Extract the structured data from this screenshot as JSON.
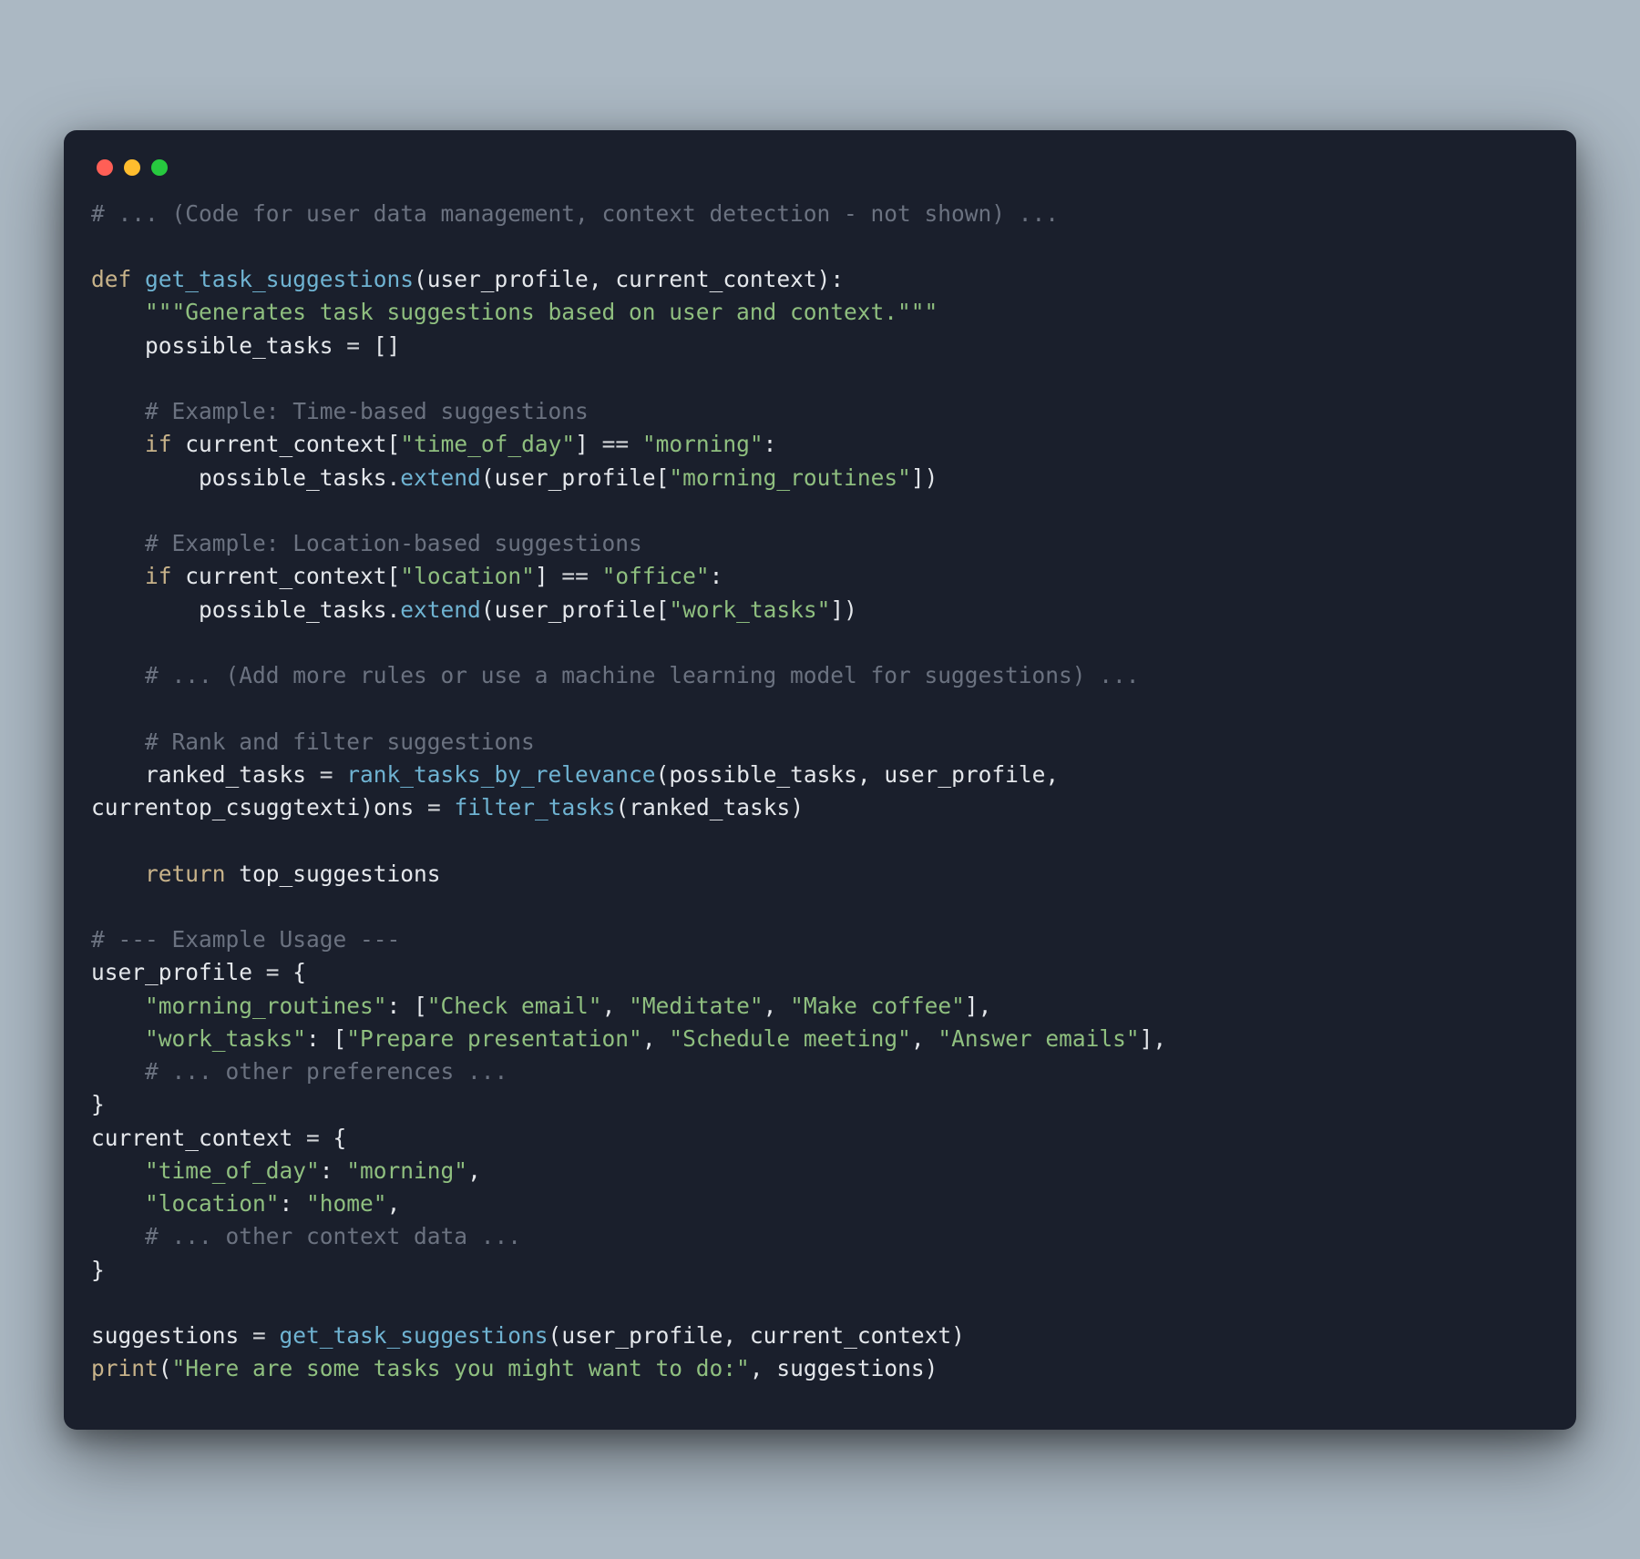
{
  "window": {
    "controls": [
      "close",
      "minimize",
      "zoom"
    ]
  },
  "code": {
    "lines": [
      {
        "indent": 0,
        "tokens": [
          {
            "t": "# ... (Code for user data management, context detection - not shown) ...",
            "c": "comment"
          }
        ]
      },
      {
        "indent": 0,
        "tokens": []
      },
      {
        "indent": 0,
        "tokens": [
          {
            "t": "def ",
            "c": "kw"
          },
          {
            "t": "get_task_suggestions",
            "c": "fn"
          },
          {
            "t": "(",
            "c": "punc"
          },
          {
            "t": "user_profile",
            "c": "name"
          },
          {
            "t": ", ",
            "c": "punc"
          },
          {
            "t": "current_context",
            "c": "name"
          },
          {
            "t": "):",
            "c": "punc"
          }
        ]
      },
      {
        "indent": 1,
        "tokens": [
          {
            "t": "\"\"\"Generates task suggestions based on user and context.\"\"\"",
            "c": "str"
          }
        ]
      },
      {
        "indent": 1,
        "tokens": [
          {
            "t": "possible_tasks ",
            "c": "name"
          },
          {
            "t": "= ",
            "c": "op"
          },
          {
            "t": "[]",
            "c": "punc"
          }
        ]
      },
      {
        "indent": 0,
        "tokens": []
      },
      {
        "indent": 1,
        "tokens": [
          {
            "t": "# Example: Time-based suggestions",
            "c": "comment"
          }
        ]
      },
      {
        "indent": 1,
        "tokens": [
          {
            "t": "if ",
            "c": "kw"
          },
          {
            "t": "current_context",
            "c": "name"
          },
          {
            "t": "[",
            "c": "punc"
          },
          {
            "t": "\"time_of_day\"",
            "c": "str"
          },
          {
            "t": "]",
            "c": "punc"
          },
          {
            "t": " == ",
            "c": "op"
          },
          {
            "t": "\"morning\"",
            "c": "str"
          },
          {
            "t": ":",
            "c": "punc"
          }
        ]
      },
      {
        "indent": 2,
        "tokens": [
          {
            "t": "possible_tasks",
            "c": "name"
          },
          {
            "t": ".",
            "c": "punc"
          },
          {
            "t": "extend",
            "c": "call"
          },
          {
            "t": "(",
            "c": "punc"
          },
          {
            "t": "user_profile",
            "c": "name"
          },
          {
            "t": "[",
            "c": "punc"
          },
          {
            "t": "\"morning_routines\"",
            "c": "str"
          },
          {
            "t": "])",
            "c": "punc"
          }
        ]
      },
      {
        "indent": 0,
        "tokens": []
      },
      {
        "indent": 1,
        "tokens": [
          {
            "t": "# Example: Location-based suggestions",
            "c": "comment"
          }
        ]
      },
      {
        "indent": 1,
        "tokens": [
          {
            "t": "if ",
            "c": "kw"
          },
          {
            "t": "current_context",
            "c": "name"
          },
          {
            "t": "[",
            "c": "punc"
          },
          {
            "t": "\"location\"",
            "c": "str"
          },
          {
            "t": "]",
            "c": "punc"
          },
          {
            "t": " == ",
            "c": "op"
          },
          {
            "t": "\"office\"",
            "c": "str"
          },
          {
            "t": ":",
            "c": "punc"
          }
        ]
      },
      {
        "indent": 2,
        "tokens": [
          {
            "t": "possible_tasks",
            "c": "name"
          },
          {
            "t": ".",
            "c": "punc"
          },
          {
            "t": "extend",
            "c": "call"
          },
          {
            "t": "(",
            "c": "punc"
          },
          {
            "t": "user_profile",
            "c": "name"
          },
          {
            "t": "[",
            "c": "punc"
          },
          {
            "t": "\"work_tasks\"",
            "c": "str"
          },
          {
            "t": "])",
            "c": "punc"
          }
        ]
      },
      {
        "indent": 0,
        "tokens": []
      },
      {
        "indent": 1,
        "tokens": [
          {
            "t": "# ... (Add more rules or use a machine learning model for suggestions) ...",
            "c": "comment"
          }
        ]
      },
      {
        "indent": 0,
        "tokens": []
      },
      {
        "indent": 1,
        "tokens": [
          {
            "t": "# Rank and filter suggestions",
            "c": "comment"
          }
        ]
      },
      {
        "indent": 1,
        "tokens": [
          {
            "t": "ranked_tasks ",
            "c": "name"
          },
          {
            "t": "= ",
            "c": "op"
          },
          {
            "t": "rank_tasks_by_relevance",
            "c": "call"
          },
          {
            "t": "(",
            "c": "punc"
          },
          {
            "t": "possible_tasks",
            "c": "name"
          },
          {
            "t": ", ",
            "c": "punc"
          },
          {
            "t": "user_profile",
            "c": "name"
          },
          {
            "t": ", ",
            "c": "punc"
          }
        ]
      },
      {
        "raw": true,
        "tokens": [
          {
            "t": "curr",
            "c": "name"
          },
          {
            "t": "ent",
            "c": "name"
          },
          {
            "t": "op",
            "c": "name"
          },
          {
            "t": "_",
            "c": "name"
          },
          {
            "t": "c",
            "c": "name"
          },
          {
            "t": "s",
            "c": "name"
          },
          {
            "t": "u",
            "c": "name"
          },
          {
            "t": "g",
            "c": "name"
          },
          {
            "t": "g",
            "c": "name"
          },
          {
            "t": "t",
            "c": "name"
          },
          {
            "t": "e",
            "c": "name"
          },
          {
            "t": "x",
            "c": "name"
          },
          {
            "t": "t",
            "c": "name"
          },
          {
            "t": "i",
            "c": "name"
          },
          {
            "t": ")",
            "c": "punc"
          },
          {
            "t": "ons ",
            "c": "name"
          },
          {
            "t": "= ",
            "c": "op"
          },
          {
            "t": "filter_tasks",
            "c": "call"
          },
          {
            "t": "(",
            "c": "punc"
          },
          {
            "t": "ranked_tasks",
            "c": "name"
          },
          {
            "t": ")",
            "c": "punc"
          }
        ]
      },
      {
        "indent": 0,
        "tokens": []
      },
      {
        "indent": 1,
        "tokens": [
          {
            "t": "return ",
            "c": "kw"
          },
          {
            "t": "top_suggestions",
            "c": "name"
          }
        ]
      },
      {
        "indent": 0,
        "tokens": []
      },
      {
        "indent": 0,
        "tokens": [
          {
            "t": "# --- Example Usage ---",
            "c": "comment"
          }
        ]
      },
      {
        "indent": 0,
        "tokens": [
          {
            "t": "user_profile ",
            "c": "name"
          },
          {
            "t": "= ",
            "c": "op"
          },
          {
            "t": "{",
            "c": "punc"
          }
        ]
      },
      {
        "indent": 1,
        "tokens": [
          {
            "t": "\"morning_routines\"",
            "c": "str"
          },
          {
            "t": ": [",
            "c": "punc"
          },
          {
            "t": "\"Check email\"",
            "c": "str"
          },
          {
            "t": ", ",
            "c": "punc"
          },
          {
            "t": "\"Meditate\"",
            "c": "str"
          },
          {
            "t": ", ",
            "c": "punc"
          },
          {
            "t": "\"Make coffee\"",
            "c": "str"
          },
          {
            "t": "],",
            "c": "punc"
          }
        ]
      },
      {
        "indent": 1,
        "tokens": [
          {
            "t": "\"work_tasks\"",
            "c": "str"
          },
          {
            "t": ": [",
            "c": "punc"
          },
          {
            "t": "\"Prepare presentation\"",
            "c": "str"
          },
          {
            "t": ", ",
            "c": "punc"
          },
          {
            "t": "\"Schedule meeting\"",
            "c": "str"
          },
          {
            "t": ", ",
            "c": "punc"
          },
          {
            "t": "\"Answer emails\"",
            "c": "str"
          },
          {
            "t": "],",
            "c": "punc"
          }
        ]
      },
      {
        "indent": 1,
        "tokens": [
          {
            "t": "# ... other preferences ...",
            "c": "comment"
          }
        ]
      },
      {
        "indent": 0,
        "tokens": [
          {
            "t": "}",
            "c": "punc"
          }
        ]
      },
      {
        "indent": 0,
        "tokens": [
          {
            "t": "current_context ",
            "c": "name"
          },
          {
            "t": "= ",
            "c": "op"
          },
          {
            "t": "{",
            "c": "punc"
          }
        ]
      },
      {
        "indent": 1,
        "tokens": [
          {
            "t": "\"time_of_day\"",
            "c": "str"
          },
          {
            "t": ": ",
            "c": "punc"
          },
          {
            "t": "\"morning\"",
            "c": "str"
          },
          {
            "t": ",",
            "c": "punc"
          }
        ]
      },
      {
        "indent": 1,
        "tokens": [
          {
            "t": "\"location\"",
            "c": "str"
          },
          {
            "t": ": ",
            "c": "punc"
          },
          {
            "t": "\"home\"",
            "c": "str"
          },
          {
            "t": ",",
            "c": "punc"
          }
        ]
      },
      {
        "indent": 1,
        "tokens": [
          {
            "t": "# ... other context data ...",
            "c": "comment"
          }
        ]
      },
      {
        "indent": 0,
        "tokens": [
          {
            "t": "}",
            "c": "punc"
          }
        ]
      },
      {
        "indent": 0,
        "tokens": []
      },
      {
        "indent": 0,
        "tokens": [
          {
            "t": "suggestions ",
            "c": "name"
          },
          {
            "t": "= ",
            "c": "op"
          },
          {
            "t": "get_task_suggestions",
            "c": "call"
          },
          {
            "t": "(",
            "c": "punc"
          },
          {
            "t": "user_profile",
            "c": "name"
          },
          {
            "t": ", ",
            "c": "punc"
          },
          {
            "t": "current_context",
            "c": "name"
          },
          {
            "t": ")",
            "c": "punc"
          }
        ]
      },
      {
        "indent": 0,
        "tokens": [
          {
            "t": "print",
            "c": "builtin"
          },
          {
            "t": "(",
            "c": "punc"
          },
          {
            "t": "\"Here are some tasks you might want to do:\"",
            "c": "str"
          },
          {
            "t": ", ",
            "c": "punc"
          },
          {
            "t": "suggestions",
            "c": "name"
          },
          {
            "t": ")",
            "c": "punc"
          }
        ]
      }
    ]
  }
}
